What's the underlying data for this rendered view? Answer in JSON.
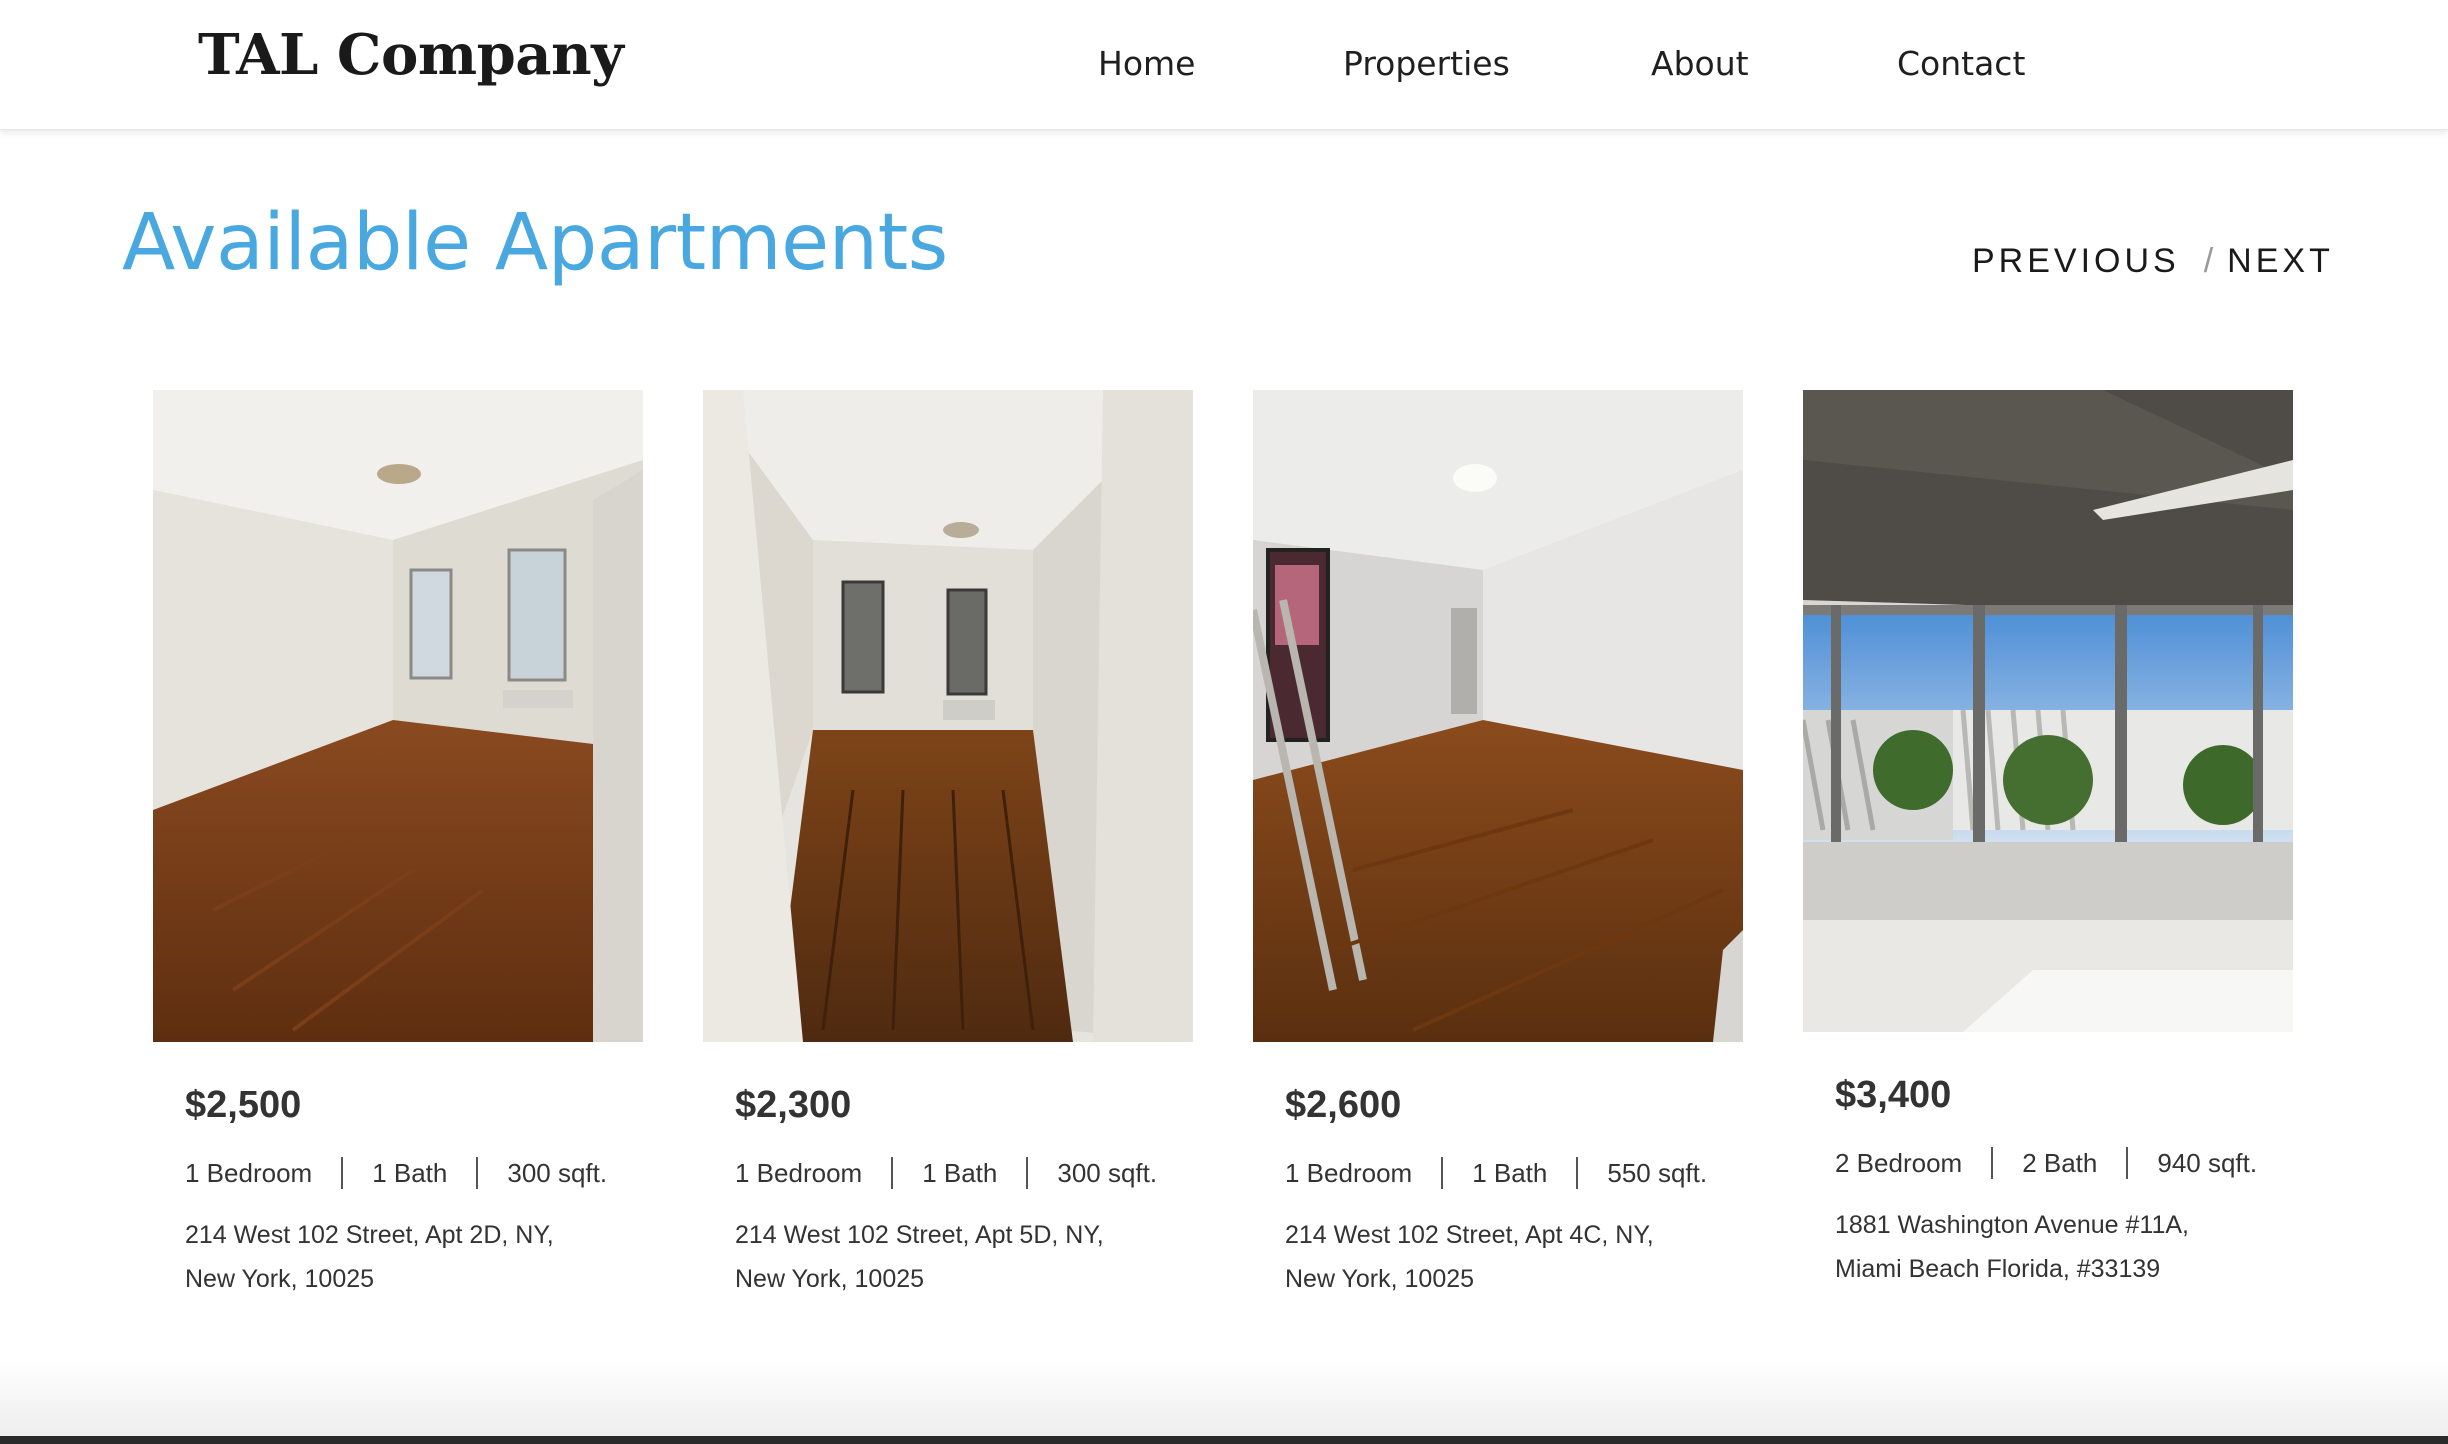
{
  "header": {
    "logo": "TAL Company",
    "nav": {
      "home": "Home",
      "properties": "Properties",
      "about": "About",
      "contact": "Contact"
    }
  },
  "section": {
    "title": "Available Apartments",
    "pager": {
      "previous": "PREVIOUS",
      "separator": "/",
      "next": "NEXT"
    }
  },
  "colors": {
    "accent": "#4aa8e0",
    "text": "#333333"
  },
  "listings": [
    {
      "price": "$2,500",
      "bedrooms": "1 Bedroom",
      "baths": "1 Bath",
      "area": "300 sqft.",
      "address_line1": "214 West 102 Street, Apt 2D, NY,",
      "address_line2": "New York, 10025"
    },
    {
      "price": "$2,300",
      "bedrooms": "1 Bedroom",
      "baths": "1 Bath",
      "area": "300 sqft.",
      "address_line1": "214 West 102 Street, Apt 5D, NY,",
      "address_line2": "New York, 10025"
    },
    {
      "price": "$2,600",
      "bedrooms": "1 Bedroom",
      "baths": "1 Bath",
      "area": "550 sqft.",
      "address_line1": "214 West 102 Street, Apt 4C, NY,",
      "address_line2": "New York, 10025"
    },
    {
      "price": "$3,400",
      "bedrooms": "2 Bedroom",
      "baths": "2 Bath",
      "area": "940 sqft.",
      "address_line1": "1881 Washington Avenue #11A,",
      "address_line2": "Miami Beach Florida, #33139"
    }
  ]
}
